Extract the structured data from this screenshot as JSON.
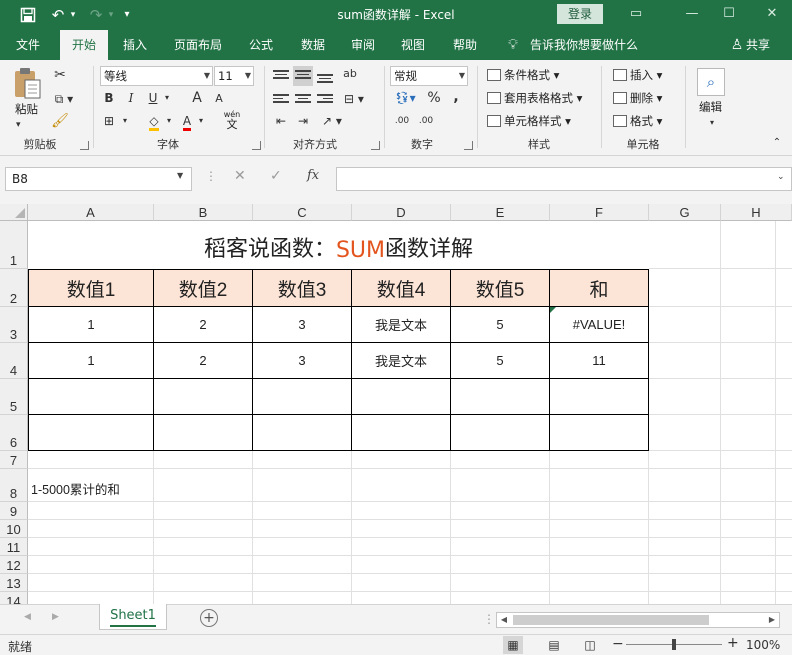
{
  "window": {
    "title": "sum函数详解  -  Excel",
    "login_label": "登录",
    "quick_access": {
      "save_icon": "save-icon",
      "undo_icon": "undo-icon",
      "redo_icon": "redo-icon",
      "customize_icon": "customize-icon"
    }
  },
  "menu": {
    "tabs": [
      "文件",
      "开始",
      "插入",
      "页面布局",
      "公式",
      "数据",
      "审阅",
      "视图",
      "帮助"
    ],
    "active_tab": "开始",
    "tell_me": "告诉我你想要做什么",
    "share": "共享"
  },
  "ribbon": {
    "clipboard": {
      "paste": "粘贴",
      "label": "剪贴板"
    },
    "font": {
      "name": "等线",
      "size": "11",
      "bold": "B",
      "italic": "I",
      "underline": "U",
      "grow": "A",
      "shrink": "A",
      "font_color_glyph": "A",
      "wen": "wén",
      "wen_char": "文",
      "label": "字体"
    },
    "alignment": {
      "wrap_glyph": "ab",
      "label": "对齐方式"
    },
    "number": {
      "format": "常规",
      "percent": "%",
      "comma": ",",
      "inc_dec": ".00",
      "label": "数字"
    },
    "styles": {
      "conditional": "条件格式",
      "table": "套用表格格式",
      "cell_styles": "单元格样式",
      "label": "样式"
    },
    "cells": {
      "insert": "插入",
      "delete": "删除",
      "format": "格式",
      "label": "单元格"
    },
    "editing": {
      "label": "编辑"
    }
  },
  "formula_bar": {
    "name_box": "B8",
    "fx": "fx",
    "formula": ""
  },
  "columns": [
    "A",
    "B",
    "C",
    "D",
    "E",
    "F",
    "G",
    "H"
  ],
  "rows": [
    "1",
    "2",
    "3",
    "4",
    "5",
    "6",
    "7",
    "8",
    "9",
    "10",
    "11",
    "12",
    "13",
    "14"
  ],
  "sheet": {
    "title_prefix": "稻客说函数：",
    "title_accent": "SUM",
    "title_suffix": "函数详解",
    "headers": [
      "数值1",
      "数值2",
      "数值3",
      "数值4",
      "数值5",
      "和"
    ],
    "row3": [
      "1",
      "2",
      "3",
      "我是文本",
      "5",
      "#VALUE!"
    ],
    "row4": [
      "1",
      "2",
      "3",
      "我是文本",
      "5",
      "11"
    ],
    "a8": "1-5000累计的和"
  },
  "sheet_tabs": {
    "active": "Sheet1"
  },
  "status": {
    "mode": "就绪",
    "zoom": "100%",
    "zoom_minus": "−",
    "zoom_plus": "+"
  }
}
